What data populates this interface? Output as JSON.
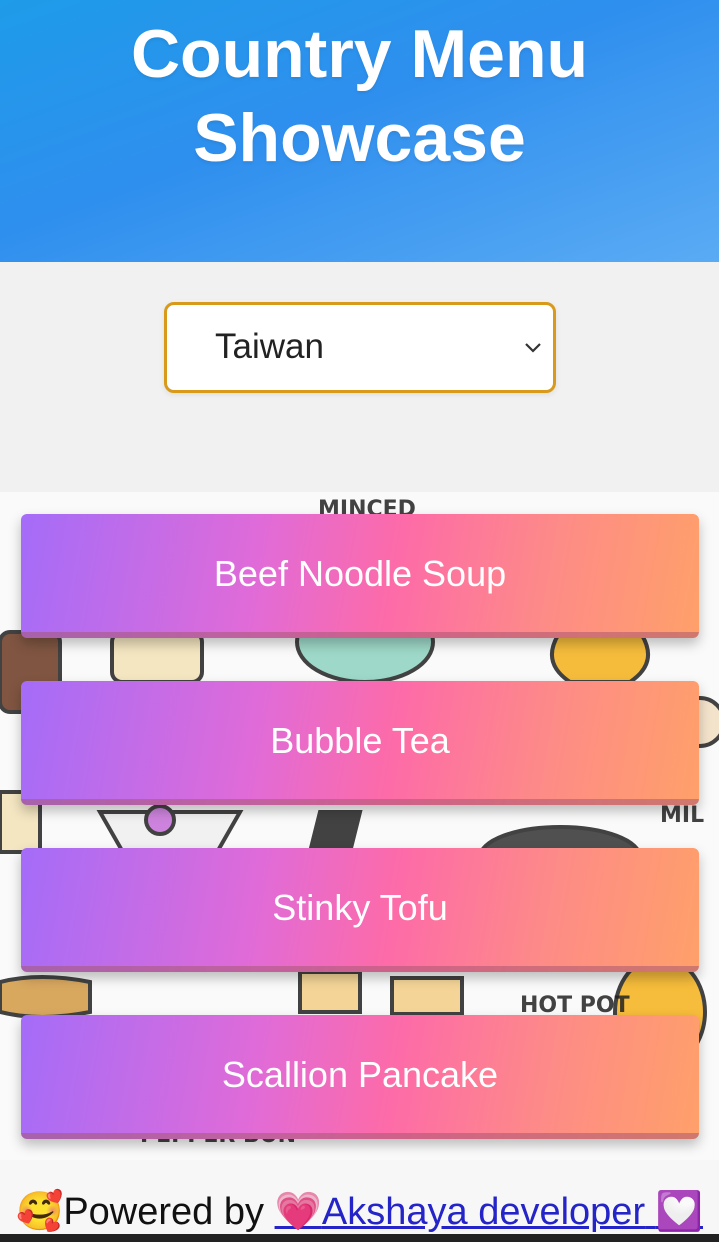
{
  "header": {
    "title_line1": "Country Menu",
    "title_line2": "Showcase"
  },
  "country_select": {
    "selected": "Taiwan",
    "icon": "chevron-down-icon"
  },
  "menu_items": [
    {
      "label": "Beef Noodle Soup"
    },
    {
      "label": "Bubble Tea"
    },
    {
      "label": "Stinky Tofu"
    },
    {
      "label": "Scallion Pancake"
    }
  ],
  "footer": {
    "prefix_emoji": "🥰",
    "powered_by": "Powered by",
    "link_emoji": "💗",
    "link_text": "Akshaya developer",
    "suffix_emoji": "💟"
  },
  "colors": {
    "header_gradient": [
      "#1e9be9",
      "#5aabf4"
    ],
    "select_border": "#d99a1c",
    "button_gradient": [
      "#a46cf8",
      "#fd6ba8",
      "#ffa06a"
    ],
    "link": "#2424c8"
  }
}
